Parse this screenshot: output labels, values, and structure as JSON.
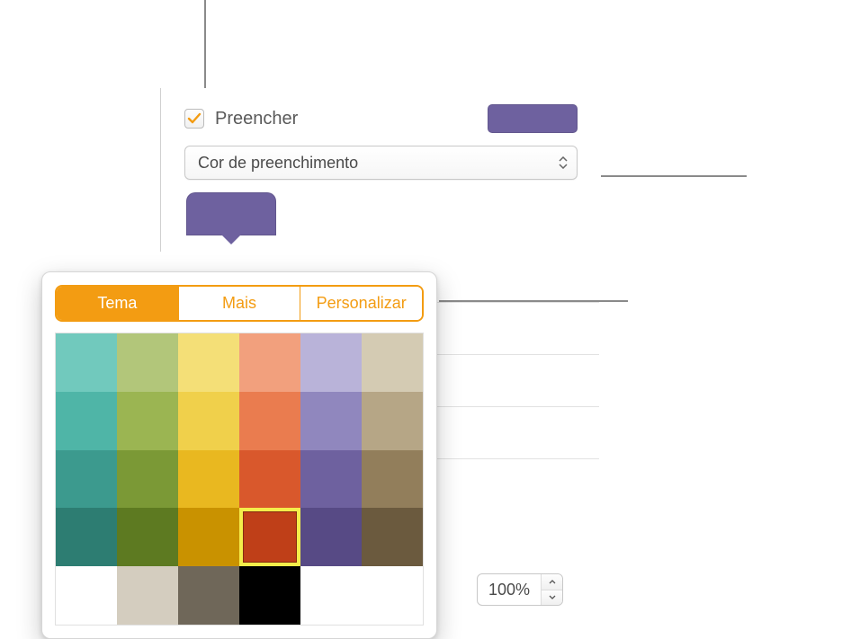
{
  "fill": {
    "checkbox_label": "Preencher",
    "checked": true,
    "preview_color": "#6e619f",
    "dropdown_label": "Cor de preenchimento",
    "well_color": "#6e619f"
  },
  "popover": {
    "tabs": [
      {
        "label": "Tema",
        "active": true
      },
      {
        "label": "Mais",
        "active": false
      },
      {
        "label": "Personalizar",
        "active": false
      }
    ],
    "selected_index": 21,
    "colors": [
      "#71c9bd",
      "#b2c67a",
      "#f4df77",
      "#f2a07d",
      "#b9b3d9",
      "#d4cbb3",
      "#4fb5a7",
      "#9bb552",
      "#f0d04b",
      "#ea7c4f",
      "#9087be",
      "#b6a686",
      "#3c9a8e",
      "#7b9936",
      "#e9b820",
      "#d9582c",
      "#6e619f",
      "#927e5b",
      "#2d7d72",
      "#5d7a21",
      "#c99200",
      "#bf3f18",
      "#574a85",
      "#6b5a3e",
      "#ffffff",
      "#d4cdbf",
      "#6f6759",
      "#000000",
      "#ffffff",
      "#ffffff"
    ],
    "last_row_visible": 4
  },
  "opacity": {
    "value": "100%"
  }
}
